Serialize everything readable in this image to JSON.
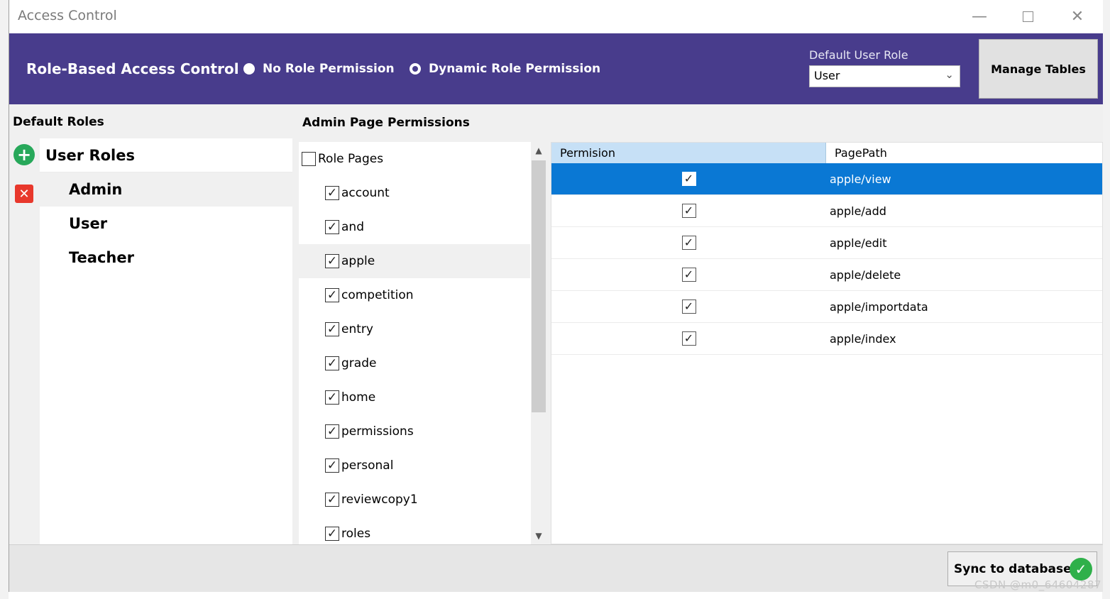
{
  "window": {
    "title": "Access Control"
  },
  "header": {
    "title": "Role-Based Access Control",
    "radio_no": "No Role Permission",
    "radio_dynamic": "Dynamic Role Permission",
    "default_role_label": "Default User Role",
    "default_role_value": "User",
    "manage_tables": "Manage Tables"
  },
  "roles": {
    "section_title": "Default Roles",
    "header": "User Roles",
    "items": [
      {
        "label": "Admin",
        "selected": true
      },
      {
        "label": "User",
        "selected": false
      },
      {
        "label": "Teacher",
        "selected": false
      }
    ]
  },
  "pages": {
    "section_title": "Admin Page Permissions",
    "root_label": "Role Pages",
    "items": [
      {
        "label": "account",
        "checked": true
      },
      {
        "label": "and",
        "checked": true
      },
      {
        "label": "apple",
        "checked": true,
        "selected": true
      },
      {
        "label": "competition",
        "checked": true
      },
      {
        "label": "entry",
        "checked": true
      },
      {
        "label": "grade",
        "checked": true
      },
      {
        "label": "home",
        "checked": true
      },
      {
        "label": "permissions",
        "checked": true
      },
      {
        "label": "personal",
        "checked": true
      },
      {
        "label": "reviewcopy1",
        "checked": true
      },
      {
        "label": "roles",
        "checked": true
      }
    ]
  },
  "grid": {
    "col_permission": "Permision",
    "col_pagepath": "PagePath",
    "rows": [
      {
        "path": "apple/view",
        "checked": true,
        "selected": true
      },
      {
        "path": "apple/add",
        "checked": true
      },
      {
        "path": "apple/edit",
        "checked": true
      },
      {
        "path": "apple/delete",
        "checked": true
      },
      {
        "path": "apple/importdata",
        "checked": true
      },
      {
        "path": "apple/index",
        "checked": true
      }
    ]
  },
  "footer": {
    "sync_label": "Sync to database"
  },
  "watermark": "CSDN @m0_64604287",
  "colors": {
    "header_bg": "#483c8c",
    "selection": "#0a78d4",
    "grid_header": "#c6e0f6",
    "add_icon": "#27a85a",
    "delete_icon": "#e8382c"
  }
}
